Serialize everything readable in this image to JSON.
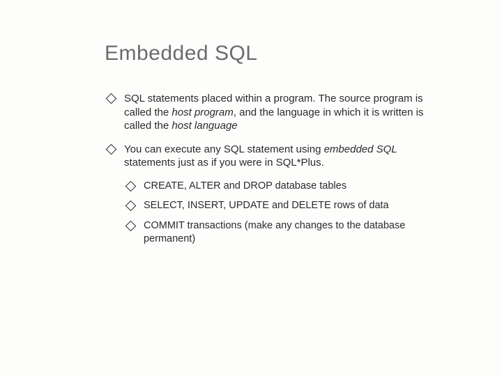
{
  "title": "Embedded SQL",
  "points": {
    "p1": {
      "a": "SQL statements placed within a program. The source program is called the ",
      "b": "host program",
      "c": ", and the language in which it is written is called the ",
      "d": "host language"
    },
    "p2": {
      "a": "You can execute any SQL statement using ",
      "b": "embedded SQL",
      "c": " statements just as if you were in SQL*Plus."
    },
    "sub1": "CREATE, ALTER and DROP database tables",
    "sub2": "SELECT, INSERT, UPDATE and DELETE rows of data",
    "sub3": "COMMIT transactions (make any changes to the database permanent)"
  }
}
